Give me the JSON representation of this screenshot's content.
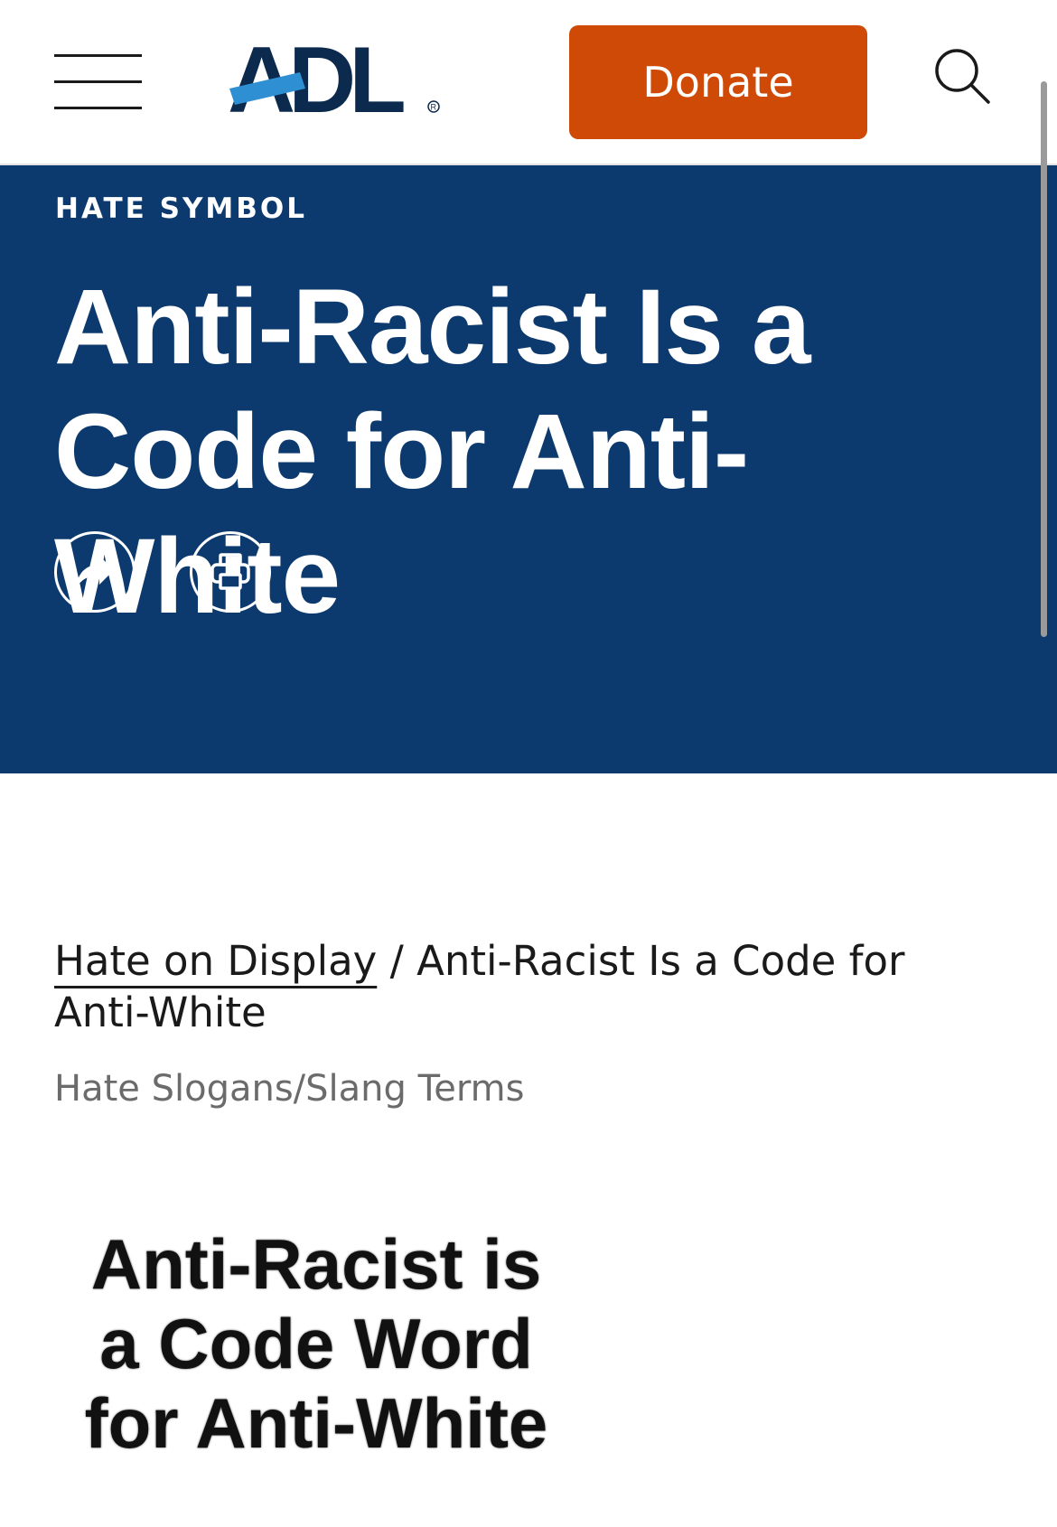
{
  "header": {
    "logo_text": "ADL",
    "logo_mark": "®",
    "donate_label": "Donate",
    "menu_icon": "hamburger-menu-icon",
    "search_icon": "search-icon",
    "brand_color": "#0c2a4e",
    "accent_color": "#cf4a06"
  },
  "hero": {
    "eyebrow": "HATE SYMBOL",
    "title": "Anti-Racist Is a Code for Anti-White",
    "background_color": "#0c3a6e",
    "actions": [
      {
        "name": "share",
        "icon": "share-arrow-icon"
      },
      {
        "name": "print",
        "icon": "printer-icon"
      }
    ]
  },
  "content": {
    "breadcrumb_link": "Hate on Display",
    "breadcrumb_separator": " / ",
    "breadcrumb_current": "Anti-Racist Is a Code for Anti-White",
    "category": "Hate Slogans/Slang Terms",
    "image_text": "Anti-Racist is\na Code Word\nfor Anti-White"
  }
}
